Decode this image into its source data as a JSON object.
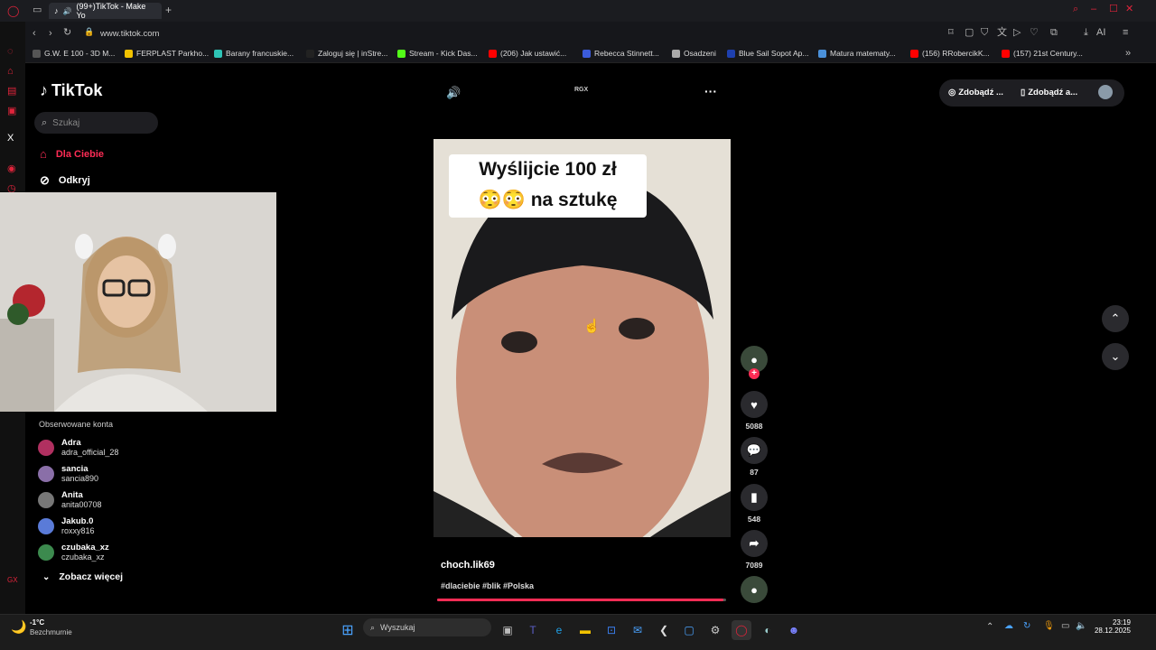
{
  "browser": {
    "tab_title": "(99+)TikTok - Make Yo",
    "add_tab": "+",
    "url": "www.tiktok.com",
    "bookmarks": [
      {
        "label": "G.W. E 100 - 3D M...",
        "color": "#555"
      },
      {
        "label": "FERPLAST Parkho...",
        "color": "#f2c200"
      },
      {
        "label": "Barany francuskie...",
        "color": "#2ec4b6"
      },
      {
        "label": "Zaloguj się | inStre...",
        "color": "#222"
      },
      {
        "label": "Stream - Kick Das...",
        "color": "#53fc18"
      },
      {
        "label": "(206) Jak ustawić...",
        "color": "#ff0000"
      },
      {
        "label": "Rebecca Stinnett...",
        "color": "#3b5bdb"
      },
      {
        "label": "Osadzeni",
        "color": "#aaa"
      },
      {
        "label": "Blue Sail Sopot Ap...",
        "color": "#1e40af"
      },
      {
        "label": "Matura matematy...",
        "color": "#4a90d9"
      },
      {
        "label": "(156) RRobercikK...",
        "color": "#ff0000"
      },
      {
        "label": "(157) 21st Century...",
        "color": "#ff0000"
      }
    ]
  },
  "tiktok": {
    "logo": "TikTok",
    "search_placeholder": "Szukaj",
    "nav": {
      "for_you": "Dla Ciebie",
      "explore": "Odkryj"
    },
    "header_right": {
      "coins": "Zdobądź ...",
      "app": "Zdobądź a..."
    },
    "center_label": "RGX",
    "following_title": "Obserwowane konta",
    "following": [
      {
        "name": "Adra",
        "handle": "adra_official_28",
        "color": "#b03060"
      },
      {
        "name": "sancia",
        "handle": "sancia890",
        "color": "#8a6fa8"
      },
      {
        "name": "Anita",
        "handle": "anita00708",
        "color": "#777"
      },
      {
        "name": "Jakub.0",
        "handle": "roxxy816",
        "color": "#5a7bd8"
      },
      {
        "name": "czubaka_xz",
        "handle": "czubaka_xz",
        "color": "#3c8a4e"
      }
    ],
    "see_more": "Zobacz więcej",
    "video": {
      "overlay_text_line1": "Wyślijcie 100 zł",
      "overlay_text_line2": "😳😳 na sztukę",
      "author": "choch.lik69",
      "hashtags": "#dlaciebie #blik #Polska",
      "progress": 0.99
    },
    "actions": {
      "likes": "5088",
      "comments": "87",
      "saves": "548",
      "shares": "7089"
    }
  },
  "taskbar": {
    "weather_temp": "-1°C",
    "weather_desc": "Bezchmurnie",
    "search_placeholder": "Wyszukaj",
    "time": "23:19",
    "date": "28.12.2025"
  },
  "colors": {
    "accent": "#fe2c55"
  }
}
